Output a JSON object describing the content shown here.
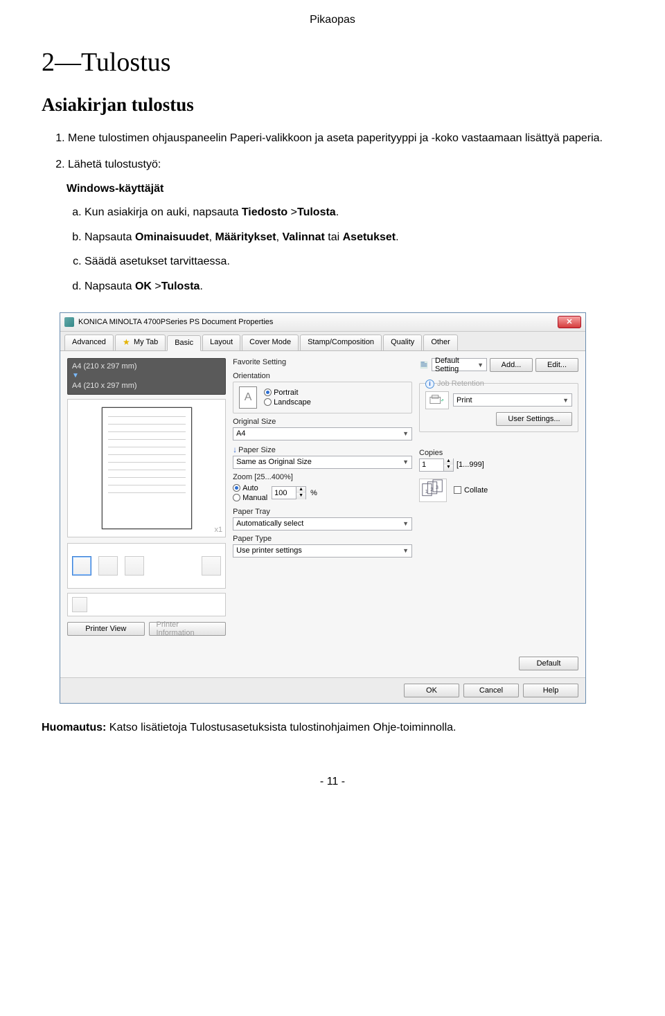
{
  "page_header": "Pikaopas",
  "chapter_title": "2—Tulostus",
  "section_title": "Asiakirjan tulostus",
  "steps": [
    "Mene tulostimen ohjauspaneelin Paperi-valikkoon ja aseta paperityyppi ja -koko vastaamaan lisättyä paperia.",
    "Lähetä tulostustyö:"
  ],
  "subhead": "Windows-käyttäjät",
  "substeps": {
    "a_pre": "Kun asiakirja on auki, napsauta ",
    "a_b1": "Tiedosto",
    "a_mid": " >",
    "a_b2": "Tulosta",
    "a_post": ".",
    "b_pre": "Napsauta ",
    "b_b1": "Ominaisuudet",
    "b_c1": ", ",
    "b_b2": "Määritykset",
    "b_c2": ", ",
    "b_b3": "Valinnat",
    "b_c3": " tai ",
    "b_b4": "Asetukset",
    "b_post": ".",
    "c": "Säädä asetukset tarvittaessa.",
    "d_pre": "Napsauta ",
    "d_b1": "OK",
    "d_mid": " >",
    "d_b2": "Tulosta",
    "d_post": "."
  },
  "dialog": {
    "title": "KONICA MINOLTA 4700PSeries PS Document Properties",
    "tabs": [
      "Advanced",
      "My Tab",
      "Basic",
      "Layout",
      "Cover Mode",
      "Stamp/Composition",
      "Quality",
      "Other"
    ],
    "active_tab": "Basic",
    "favorite_label": "Favorite Setting",
    "favorite_value": "Default Setting",
    "add_btn": "Add...",
    "edit_btn": "Edit...",
    "preview_size1": "A4 (210 x 297 mm)",
    "preview_size2": "A4 (210 x 297 mm)",
    "x1": "x1",
    "printer_view": "Printer View",
    "printer_info": "Printer Information",
    "orientation_label": "Orientation",
    "portrait": "Portrait",
    "landscape": "Landscape",
    "original_size_label": "Original Size",
    "original_size_value": "A4",
    "paper_size_label": "Paper Size",
    "paper_size_value": "Same as Original Size",
    "zoom_label": "Zoom [25...400%]",
    "zoom_auto": "Auto",
    "zoom_manual": "Manual",
    "zoom_value": "100",
    "zoom_pct": "%",
    "paper_tray_label": "Paper Tray",
    "paper_tray_value": "Automatically select",
    "paper_type_label": "Paper Type",
    "paper_type_value": "Use printer settings",
    "job_retention_label": "Job Retention",
    "job_retention_value": "Print",
    "user_settings": "User Settings...",
    "copies_label": "Copies",
    "copies_value": "1",
    "copies_range": "[1...999]",
    "collate": "Collate",
    "default_btn": "Default",
    "ok_btn": "OK",
    "cancel_btn": "Cancel",
    "help_btn": "Help"
  },
  "note_label": "Huomautus:",
  "note_text": " Katso lisätietoja Tulostusasetuksista tulostinohjaimen Ohje-toiminnolla.",
  "page_number": "- 11 -"
}
